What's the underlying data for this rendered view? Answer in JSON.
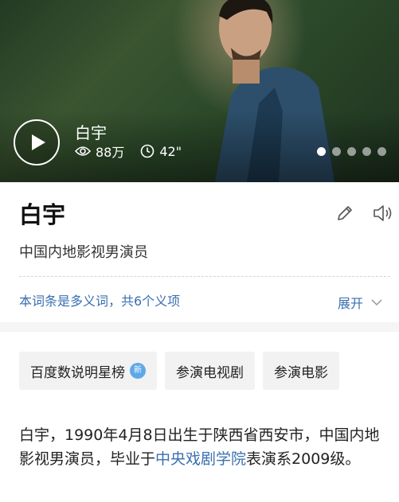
{
  "hero": {
    "video_title": "白宇",
    "views": "88万",
    "duration": "42\"",
    "carousel_total": 5,
    "carousel_active": 1
  },
  "entry": {
    "title": "白宇",
    "subtitle": "中国内地影视男演员",
    "polysemy_notice": "本词条是多义词，共6个义项",
    "expand_label": "展开"
  },
  "tags": [
    {
      "label": "百度数说明星榜",
      "badge": "新"
    },
    {
      "label": "参演电视剧"
    },
    {
      "label": "参演电影"
    }
  ],
  "summary": {
    "part1": "白宇，1990年4月8日出生于陕西省西安市，中国内地影视男演员，毕业于",
    "link": "中央戏剧学院",
    "part2": "表演系2009级。"
  },
  "icons": [
    "play-icon",
    "eye-icon",
    "clock-icon",
    "edit-icon",
    "speaker-icon",
    "chevron-down-icon"
  ],
  "colors": {
    "link": "#3a6fb0",
    "badge": "#5fa8e8"
  }
}
